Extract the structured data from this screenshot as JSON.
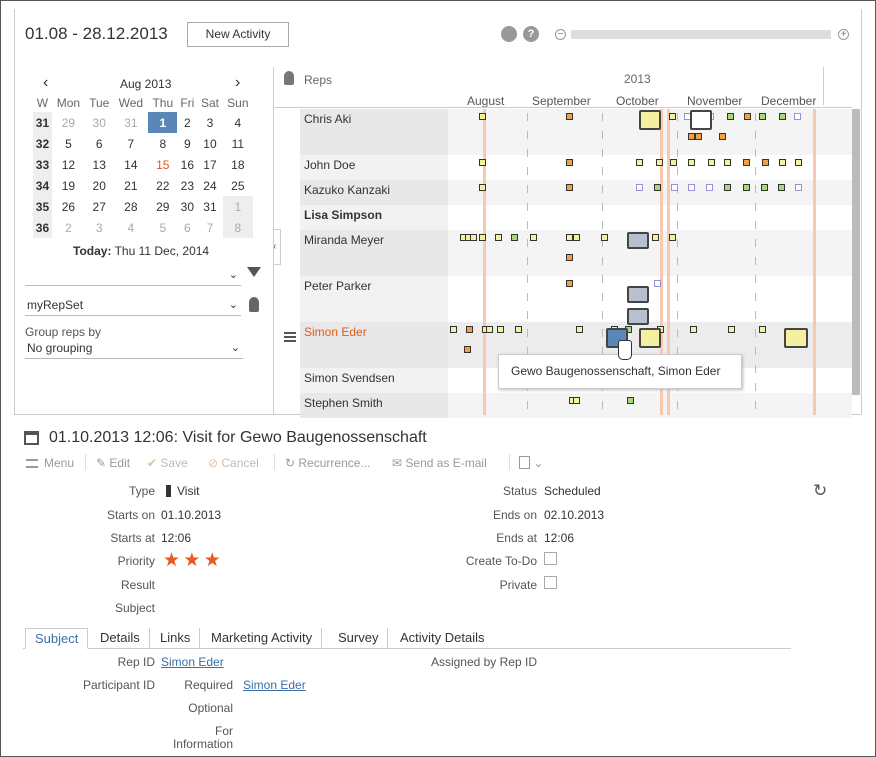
{
  "header": {
    "date_range": "01.08 - 28.12.2013",
    "new_activity": "New Activity"
  },
  "calendar": {
    "month": "Aug 2013",
    "prev": "‹",
    "next": "›",
    "day_headers": [
      "W",
      "Mon",
      "Tue",
      "Wed",
      "Thu",
      "Fri",
      "Sat",
      "Sun"
    ],
    "weeks": [
      [
        "31",
        "29",
        "30",
        "31",
        "1",
        "2",
        "3",
        "4"
      ],
      [
        "32",
        "5",
        "6",
        "7",
        "8",
        "9",
        "10",
        "11"
      ],
      [
        "33",
        "12",
        "13",
        "14",
        "15",
        "16",
        "17",
        "18"
      ],
      [
        "34",
        "19",
        "20",
        "21",
        "22",
        "23",
        "24",
        "25"
      ],
      [
        "35",
        "26",
        "27",
        "28",
        "29",
        "30",
        "31",
        "1"
      ],
      [
        "36",
        "2",
        "3",
        "4",
        "5",
        "6",
        "7",
        "8"
      ]
    ],
    "today_label": "Today:",
    "today_value": "Thu 11 Dec, 2014"
  },
  "filters": {
    "filter1_value": "",
    "repset_value": "myRepSet",
    "group_label": "Group reps by",
    "group_value": "No grouping"
  },
  "gantt": {
    "reps_label": "Reps",
    "year": "2013",
    "months": [
      "August",
      "September",
      "October",
      "November",
      "December"
    ],
    "reps": [
      "Chris Aki",
      "John Doe",
      "Kazuko Kanzaki",
      "Lisa Simpson",
      "Miranda Meyer",
      "Peter Parker",
      "Simon Eder",
      "Simon Svendsen",
      "Stephen Smith"
    ]
  },
  "tooltip": "Gewo Baugenossenschaft, Simon Eder",
  "detail": {
    "title": "01.10.2013 12:06: Visit for Gewo Baugenossenschaft",
    "toolbar": {
      "menu": "Menu",
      "edit": "Edit",
      "save": "Save",
      "cancel": "Cancel",
      "recurrence": "Recurrence...",
      "send_email": "Send as E-mail"
    },
    "labels": {
      "type": "Type",
      "starts_on": "Starts on",
      "starts_at": "Starts at",
      "priority": "Priority",
      "result": "Result",
      "subject": "Subject",
      "status": "Status",
      "ends_on": "Ends on",
      "ends_at": "Ends at",
      "create_todo": "Create To-Do",
      "private": "Private"
    },
    "values": {
      "type": "Visit",
      "starts_on": "01.10.2013",
      "starts_at": "12:06",
      "status": "Scheduled",
      "ends_on": "02.10.2013",
      "ends_at": "12:06"
    },
    "tabs": [
      "Subject",
      "Details",
      "Links",
      "Marketing Activity",
      "Survey",
      "Activity Details"
    ],
    "sub": {
      "rep_id_label": "Rep ID",
      "rep_id_value": "Simon Eder",
      "assigned_label": "Assigned by Rep ID",
      "participant_label": "Participant ID",
      "required_label": "Required",
      "required_value": "Simon Eder",
      "optional_label": "Optional",
      "for_info_label": "For Information"
    }
  },
  "colors": {
    "accent": "#e05a1a",
    "selected_day": "#5b86b8",
    "marker_orange": "#f0a040",
    "marker_yellow": "#f5f0a0",
    "marker_green": "#a8d878",
    "marker_purple": "#b8b0e8"
  }
}
